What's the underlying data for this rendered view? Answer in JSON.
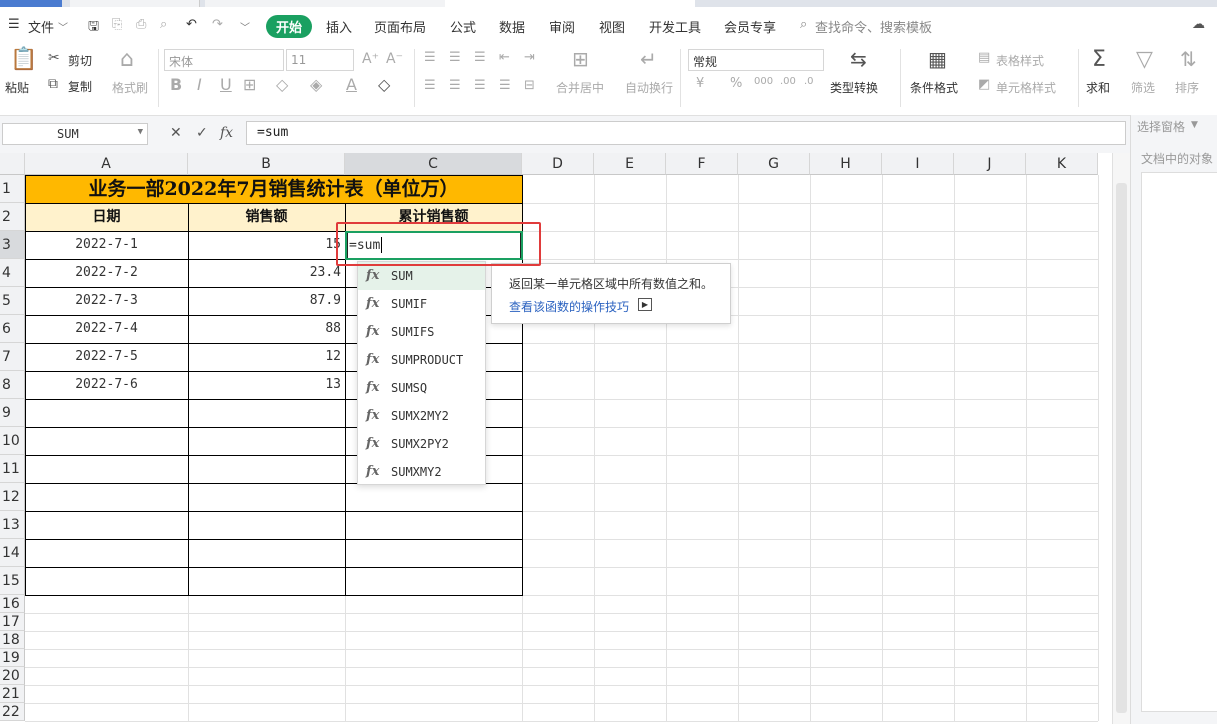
{
  "menu": {
    "file_label": "文件",
    "tabs": [
      "开始",
      "插入",
      "页面布局",
      "公式",
      "数据",
      "审阅",
      "视图",
      "开发工具",
      "会员专享"
    ],
    "active_tab": "开始",
    "search_placeholder": "查找命令、搜索模板"
  },
  "ribbon": {
    "paste": "粘贴",
    "cut": "剪切",
    "copy": "复制",
    "format_painter": "格式刷",
    "font_name": "宋体",
    "font_size": "11",
    "merge_center": "合并居中",
    "wrap_text": "自动换行",
    "number_format": "常规",
    "type_convert": "类型转换",
    "cond_format": "条件格式",
    "table_style": "表格样式",
    "cell_style": "单元格样式",
    "sum": "求和",
    "filter": "筛选",
    "sort": "排序"
  },
  "formula_bar": {
    "name_box": "SUM",
    "fx_label": "fx",
    "formula": "=sum"
  },
  "sheet": {
    "columns": [
      "A",
      "B",
      "C",
      "D",
      "E",
      "F",
      "G",
      "H",
      "I",
      "J",
      "K"
    ],
    "active_column": "C",
    "rows": [
      "1",
      "2",
      "3",
      "4",
      "5",
      "6",
      "7",
      "8",
      "9",
      "10",
      "11",
      "12",
      "13",
      "14",
      "15",
      "16",
      "17",
      "18",
      "19",
      "20",
      "21",
      "22"
    ],
    "active_row": "3",
    "title": "业务一部2022年7月销售统计表（单位万）",
    "headers": [
      "日期",
      "销售额",
      "累计销售额"
    ],
    "data": [
      [
        "2022-7-1",
        "15"
      ],
      [
        "2022-7-2",
        "23.4"
      ],
      [
        "2022-7-3",
        "87.9"
      ],
      [
        "2022-7-4",
        "88"
      ],
      [
        "2022-7-5",
        "12"
      ],
      [
        "2022-7-6",
        "13"
      ]
    ],
    "editing_text": "=sum"
  },
  "autocomplete": {
    "items": [
      "SUM",
      "SUMIF",
      "SUMIFS",
      "SUMPRODUCT",
      "SUMSQ",
      "SUMX2MY2",
      "SUMX2PY2",
      "SUMXMY2"
    ],
    "fx_glyph": "fx",
    "tooltip_desc": "返回某一单元格区域中所有数值之和。",
    "tooltip_link": "查看该函数的操作技巧"
  },
  "right_panel": {
    "title": "选择窗格",
    "subtitle": "文档中的对象"
  },
  "colors": {
    "accent": "#1aa061",
    "title_fill": "#ffb800",
    "header_fill": "#fff2cc",
    "highlight_box": "#e03b3b"
  }
}
